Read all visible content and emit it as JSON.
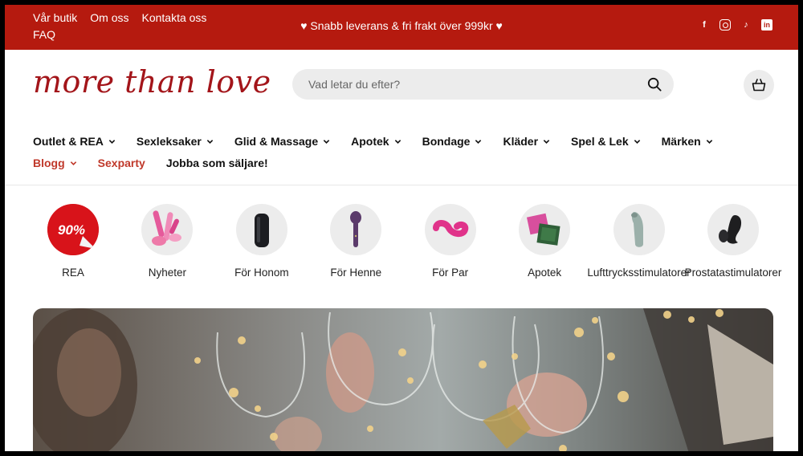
{
  "topbar": {
    "links": [
      "Vår butik",
      "Om oss",
      "Kontakta oss",
      "FAQ"
    ],
    "promo": "♥ Snabb leverans & fri frakt över 999kr ♥",
    "social": [
      {
        "name": "facebook-icon",
        "glyph": "f"
      },
      {
        "name": "instagram-icon",
        "glyph": ""
      },
      {
        "name": "tiktok-icon",
        "glyph": "♪"
      },
      {
        "name": "linkedin-icon",
        "glyph": "in"
      }
    ],
    "bg_color": "#b51a0f"
  },
  "header": {
    "logo": "more than love",
    "search_placeholder": "Vad letar du efter?"
  },
  "nav": {
    "items": [
      {
        "label": "Outlet & REA",
        "dropdown": true,
        "accent": false
      },
      {
        "label": "Sexleksaker",
        "dropdown": true,
        "accent": false
      },
      {
        "label": "Glid & Massage",
        "dropdown": true,
        "accent": false
      },
      {
        "label": "Apotek",
        "dropdown": true,
        "accent": false
      },
      {
        "label": "Bondage",
        "dropdown": true,
        "accent": false
      },
      {
        "label": "Kläder",
        "dropdown": true,
        "accent": false
      },
      {
        "label": "Spel & Lek",
        "dropdown": true,
        "accent": false
      },
      {
        "label": "Märken",
        "dropdown": true,
        "accent": false
      },
      {
        "label": "Blogg",
        "dropdown": true,
        "accent": true
      },
      {
        "label": "Sexparty",
        "dropdown": false,
        "accent": true
      },
      {
        "label": "Jobba som säljare!",
        "dropdown": false,
        "accent": false
      }
    ],
    "accent_color": "#c0392b"
  },
  "categories": [
    {
      "label": "REA",
      "badge": "90%"
    },
    {
      "label": "Nyheter"
    },
    {
      "label": "För Honom"
    },
    {
      "label": "För Henne"
    },
    {
      "label": "För Par"
    },
    {
      "label": "Apotek"
    },
    {
      "label": "Lufttrycksstimulatorer"
    },
    {
      "label": "Prostatastimulatorer"
    }
  ]
}
